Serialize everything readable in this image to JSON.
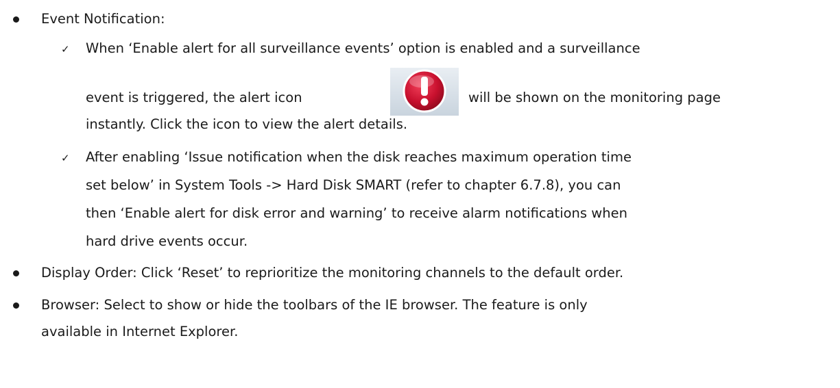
{
  "section": {
    "event_notification_label": "Event Notification:",
    "event_items": [
      {
        "lines": [
          "When ‘Enable alert for all surveillance events’ option is enabled and a surveillance",
          "event is triggered, the alert icon",
          "will be shown on the monitoring page",
          "instantly.   Click the icon to view the alert details."
        ]
      },
      {
        "lines": [
          "After enabling ‘Issue notification when the disk reaches maximum operation time",
          "set below’ in System Tools -> Hard Disk SMART (refer to chapter 6.7.8), you can",
          "then ‘Enable alert for disk error and warning’ to receive alarm notifications when",
          "hard drive events occur."
        ]
      }
    ],
    "display_order": "Display Order: Click ‘Reset’ to reprioritize the monitoring channels to the default order.",
    "browser": [
      "Browser: Select to show or hide the toolbars of the IE browser.   The feature is only",
      "available in Internet Explorer."
    ]
  },
  "icons": {
    "check": "✓",
    "alert": "alert-icon"
  },
  "colors": {
    "alert_red": "#c8102e",
    "text": "#1a1a1a"
  }
}
